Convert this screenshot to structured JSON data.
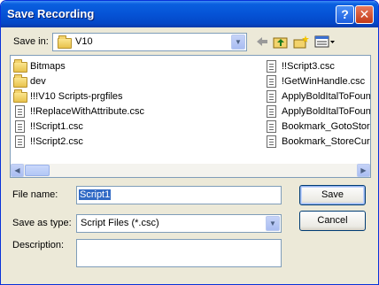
{
  "window": {
    "title": "Save Recording",
    "help_glyph": "?",
    "close_glyph": "✕"
  },
  "toolbar": {
    "save_in_label": "Save in:",
    "save_in_accel": "i",
    "save_in_value": "V10",
    "icons": [
      "back-arrow-icon",
      "up-one-level-icon",
      "new-folder-icon",
      "view-menu-icon"
    ]
  },
  "files": {
    "left_column": [
      {
        "name": "Bitmaps",
        "type": "folder"
      },
      {
        "name": "dev",
        "type": "folder"
      },
      {
        "name": "!!!V10 Scripts-prgfiles",
        "type": "folder-shortcut"
      },
      {
        "name": "!!ReplaceWithAttribute.csc",
        "type": "file"
      },
      {
        "name": "!!Script1.csc",
        "type": "file"
      },
      {
        "name": "!!Script2.csc",
        "type": "file"
      }
    ],
    "right_column": [
      {
        "name": "!!Script3.csc",
        "type": "file"
      },
      {
        "name": "!GetWinHandle.csc",
        "type": "file"
      },
      {
        "name": "ApplyBoldItalToFound",
        "type": "file"
      },
      {
        "name": "ApplyBoldItalToFound",
        "type": "file"
      },
      {
        "name": "Bookmark_GotoStore",
        "type": "file"
      },
      {
        "name": "Bookmark_StoreCurre",
        "type": "file"
      }
    ]
  },
  "form": {
    "file_name_label": "File name:",
    "file_name_value": "Script1",
    "save_as_type_label": "Save as type:",
    "save_as_type_value": "Script Files (*.csc)",
    "description_label": "Description:",
    "description_value": ""
  },
  "buttons": {
    "save": "Save",
    "cancel": "Cancel"
  },
  "colors": {
    "title_bar": "#0553d6",
    "selection": "#316ac5",
    "dialog_bg": "#ece9d8"
  }
}
